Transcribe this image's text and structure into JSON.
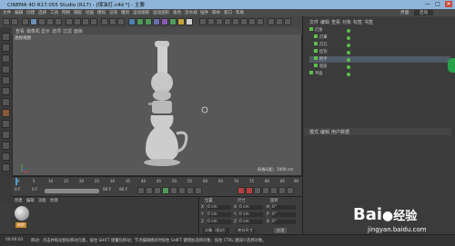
{
  "window": {
    "title": "CINEMA 4D R17.055 Studio (R17) - [煤油灯.c4d *] - 主要",
    "controls": [
      "—",
      "□",
      "✕"
    ]
  },
  "menubar": {
    "items": [
      "文件",
      "编辑",
      "创建",
      "选择",
      "工具",
      "网格",
      "捕捉",
      "动画",
      "模拟",
      "渲染",
      "雕刻",
      "运动跟踪",
      "运动图形",
      "角色",
      "流水线",
      "插件",
      "脚本",
      "窗口",
      "帮助",
      "界面:",
      "启动"
    ]
  },
  "viewport": {
    "menu": [
      "查看",
      "摄像机",
      "显示",
      "选项",
      "过滤",
      "面板"
    ],
    "label": "透视视图",
    "distance": "网格间距：1000 cm"
  },
  "object_manager": {
    "menu": [
      "文件",
      "编辑",
      "查看",
      "对象",
      "标签",
      "书签"
    ],
    "rows": [
      {
        "label": "灯身",
        "indent": 0,
        "selected": false
      },
      {
        "label": "灯罩",
        "indent": 1,
        "selected": false
      },
      {
        "label": "灯芯",
        "indent": 1,
        "selected": false
      },
      {
        "label": "挂钩",
        "indent": 1,
        "selected": false
      },
      {
        "label": "把手",
        "indent": 1,
        "selected": true
      },
      {
        "label": "底座",
        "indent": 1,
        "selected": false
      },
      {
        "label": "平面",
        "indent": 0,
        "selected": false
      }
    ]
  },
  "attribute_manager": {
    "menu": [
      "模式",
      "编辑",
      "用户数据"
    ]
  },
  "timeline": {
    "ticks": [
      "0",
      "5",
      "10",
      "15",
      "20",
      "25",
      "30",
      "35",
      "40",
      "45",
      "50",
      "55",
      "60",
      "65",
      "70",
      "75",
      "80",
      "85",
      "90"
    ],
    "frame_start": "0 F",
    "frame_current": "0 F",
    "frame_end": "90 F",
    "frame_end2": "90 F"
  },
  "material_panel": {
    "menu": [
      "创建",
      "编辑",
      "功能",
      "纹理"
    ],
    "material_name": "材质"
  },
  "coord_panel": {
    "headers": [
      "位置",
      "尺寸",
      "旋转"
    ],
    "rows": [
      {
        "axis": "X",
        "pos": "0 cm",
        "size": "0 cm",
        "rot_label": "H",
        "rot": "0°"
      },
      {
        "axis": "Y",
        "pos": "0 cm",
        "size": "0 cm",
        "rot_label": "P",
        "rot": "0°"
      },
      {
        "axis": "Z",
        "pos": "0 cm",
        "size": "0 cm",
        "rot_label": "B",
        "rot": "0°"
      }
    ],
    "mode": "对象（相对）",
    "size_mode": "绝对尺寸",
    "apply": "应用"
  },
  "status": {
    "time": "00:00:03",
    "text": "移动：点击并拖动鼠标移动元素。按住 SHIFT 键量化移动；节点编辑模式时按住 SHIFT 键增加选择对象；按住 CTRL 键减少选择对象。"
  },
  "watermark": {
    "brand": "Bai",
    "brand2": "经验",
    "url": "jingyan.baidu.com"
  },
  "colors": {
    "accent_green": "#5bc04a",
    "selection": "#505a66",
    "titlebar": "#8fb6d8"
  }
}
